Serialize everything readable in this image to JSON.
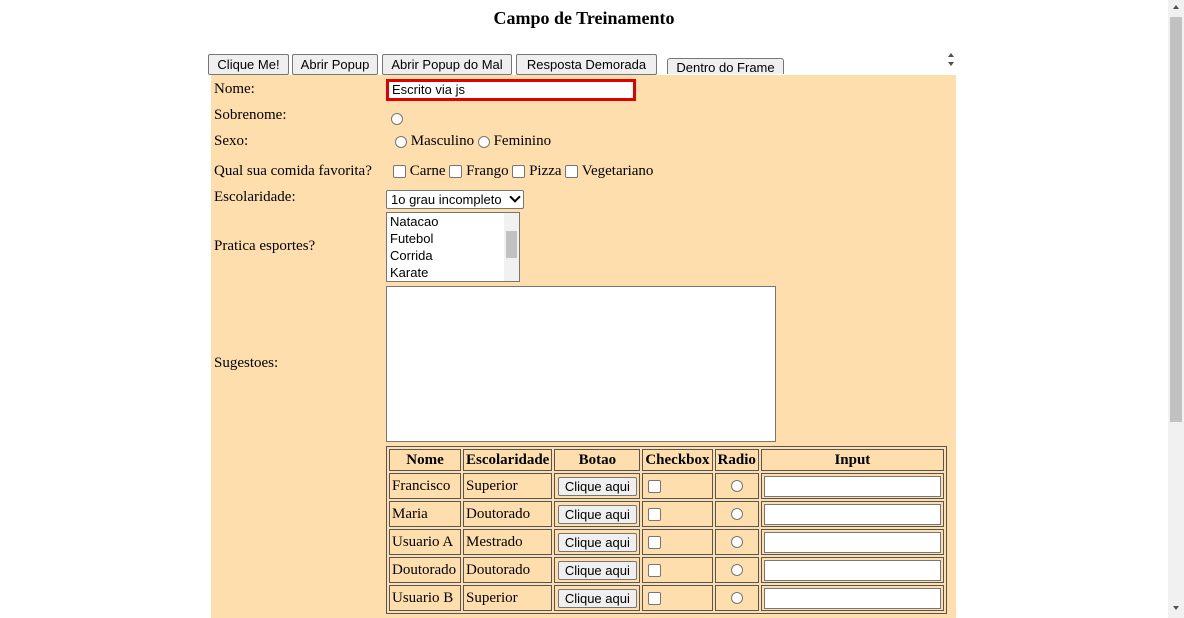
{
  "page": {
    "title": "Campo de Treinamento"
  },
  "top_buttons": [
    "Clique Me!",
    "Abrir Popup",
    "Abrir Popup do Mal",
    "Resposta Demorada"
  ],
  "frame_tab": "Dentro do Frame",
  "form": {
    "nome_label": "Nome:",
    "nome_value": "Escrito via js",
    "sobrenome_label": "Sobrenome:",
    "sexo_label": "Sexo:",
    "sexo_options": [
      "Masculino",
      "Feminino"
    ],
    "comida_label": "Qual sua comida favorita?",
    "comida_options": [
      "Carne",
      "Frango",
      "Pizza",
      "Vegetariano"
    ],
    "escolaridade_label": "Escolaridade:",
    "escolaridade_value": "1o grau incompleto",
    "esportes_label": "Pratica esportes?",
    "esportes_options": [
      "Natacao",
      "Futebol",
      "Corrida",
      "Karate"
    ],
    "sugestoes_label": "Sugestoes:"
  },
  "table": {
    "headers": [
      "Nome",
      "Escolaridade",
      "Botao",
      "Checkbox",
      "Radio",
      "Input"
    ],
    "button_label": "Clique aqui",
    "rows": [
      {
        "nome": "Francisco",
        "escolaridade": "Superior"
      },
      {
        "nome": "Maria",
        "escolaridade": "Doutorado"
      },
      {
        "nome": "Usuario A",
        "escolaridade": "Mestrado"
      },
      {
        "nome": "Doutorado",
        "escolaridade": "Doutorado"
      },
      {
        "nome": "Usuario B",
        "escolaridade": "Superior"
      }
    ]
  },
  "colors": {
    "form_background": "#ffdead",
    "highlight_border": "#e00000"
  }
}
